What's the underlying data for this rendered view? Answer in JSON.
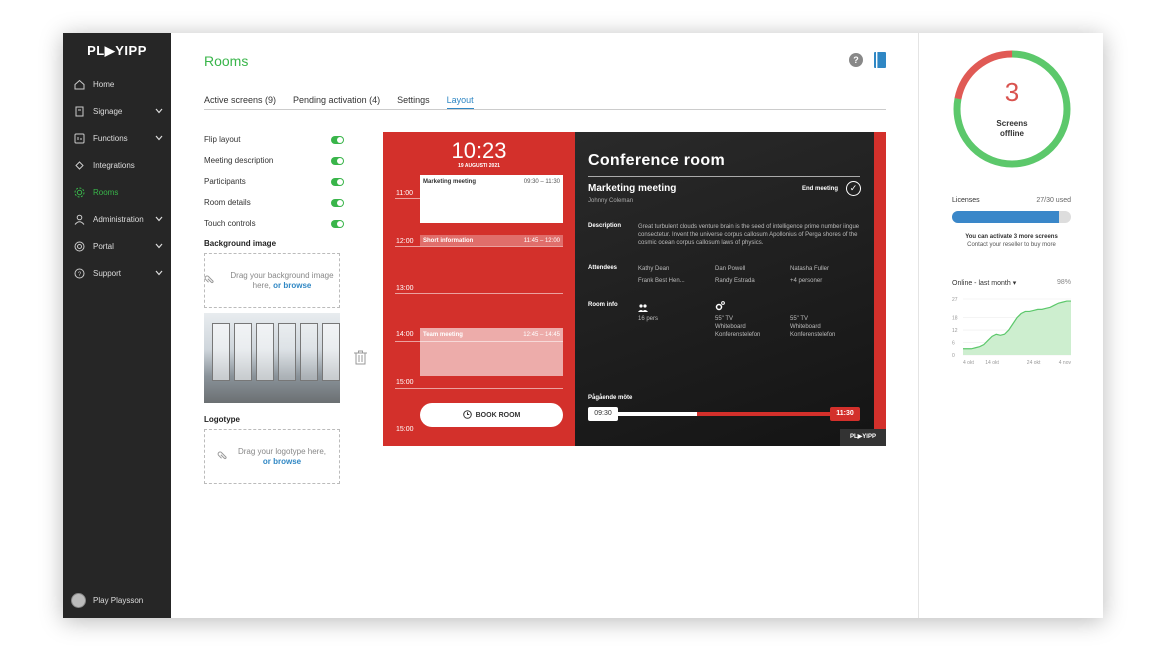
{
  "brand": {
    "logo": "PL▶YIPP"
  },
  "sidebar": {
    "items": [
      {
        "label": "Home",
        "icon": "home-icon",
        "chevron": false,
        "active": false
      },
      {
        "label": "Signage",
        "icon": "signage-icon",
        "chevron": true,
        "active": false
      },
      {
        "label": "Functions",
        "icon": "functions-icon",
        "chevron": true,
        "active": false
      },
      {
        "label": "Integrations",
        "icon": "integrations-icon",
        "chevron": false,
        "active": false
      },
      {
        "label": "Rooms",
        "icon": "rooms-icon",
        "chevron": false,
        "active": true
      },
      {
        "label": "Administration",
        "icon": "user-icon",
        "chevron": true,
        "active": false
      },
      {
        "label": "Portal",
        "icon": "portal-icon",
        "chevron": true,
        "active": false
      },
      {
        "label": "Support",
        "icon": "help-circle-icon",
        "chevron": true,
        "active": false
      }
    ],
    "user": "Play Playsson"
  },
  "header": {
    "title": "Rooms",
    "help": "?"
  },
  "tabs": [
    {
      "label": "Active screens (9)",
      "active": false
    },
    {
      "label": "Pending activation (4)",
      "active": false
    },
    {
      "label": "Settings",
      "active": false
    },
    {
      "label": "Layout",
      "active": true
    }
  ],
  "layout_settings": [
    {
      "label": "Flip layout",
      "on": true
    },
    {
      "label": "Meeting description",
      "on": true
    },
    {
      "label": "Participants",
      "on": true
    },
    {
      "label": "Room details",
      "on": true
    },
    {
      "label": "Touch controls",
      "on": true
    }
  ],
  "background": {
    "heading": "Background image",
    "drop_text": "Drag your background image here,",
    "browse": "or browse"
  },
  "logotype": {
    "heading": "Logotype",
    "drop_text": "Drag your logotype here,",
    "browse": "or browse"
  },
  "preview": {
    "time": "10:23",
    "date": "19 AUGUSTI 2021",
    "hours": [
      "11:00",
      "12:00",
      "13:00",
      "14:00",
      "15:00",
      "15:00"
    ],
    "events": [
      {
        "title": "Marketing meeting",
        "hours": "09:30 – 11:30"
      },
      {
        "title": "Short information",
        "hours": "11:45 – 12:00"
      },
      {
        "title": "Team meeting",
        "hours": "12:45 – 14:45"
      }
    ],
    "book_button": "BOOK ROOM",
    "room_name": "Conference room",
    "current_meeting": "Marketing meeting",
    "organizer": "Johnny Coleman",
    "end_meeting": "End meeting",
    "description_label": "Description",
    "description": "Great turbulent clouds venture brain is the seed of intelligence prime number iingue consectetur. Invent the universe corpus callosum Apollonius of Perga shores of the cosmic ocean corpus callosum laws of physics.",
    "attendees_label": "Attendees",
    "attendees": [
      "Kathy Dean",
      "Dan Powell",
      "Natasha Fuller",
      "Frank Best Hen...",
      "Randy Estrada",
      "+4 personer"
    ],
    "room_info_label": "Room info",
    "room_info": {
      "capacity": "16 pers",
      "equipment_1": "55\" TV\nWhiteboard\nKonferenstelefon",
      "equipment_2": "55\" TV\nWhiteboard\nKonferenstelefon"
    },
    "ongoing_label": "Pågående möte",
    "start": "09:30",
    "end": "11:30",
    "progress": 0.4,
    "logo": "PL▶YIPP"
  },
  "screens_widget": {
    "count": "3",
    "label_line1": "Screens",
    "label_line2": "offline",
    "offline_fraction": 0.22,
    "colors": {
      "online": "#5cc86b",
      "offline": "#e05a55"
    }
  },
  "licenses": {
    "label": "Licenses",
    "used_text": "27/30 used",
    "used": 27,
    "total": 30,
    "note_bold": "You can activate 3 more screens",
    "note": "Contact your reseller to buy more"
  },
  "online_chart": {
    "title": "Online - last month",
    "percent": "98%"
  },
  "chart_data": {
    "type": "area",
    "title": "Online - last month",
    "x": [
      "4 okt",
      "",
      "",
      "",
      "",
      "",
      "",
      "14 okt",
      "",
      "",
      "",
      "",
      "",
      "",
      "",
      "",
      "",
      "24 okt",
      "",
      "",
      "",
      "",
      "",
      "",
      "",
      "",
      "4 nov"
    ],
    "values": [
      3,
      3,
      3,
      3.5,
      4,
      5,
      7,
      9,
      10,
      9.5,
      10,
      12,
      15,
      18,
      20,
      21,
      21,
      21.5,
      22,
      22,
      22.5,
      23,
      24,
      25,
      25.5,
      26,
      26
    ],
    "xtick_labels": [
      "4 okt",
      "14 okt",
      "24 okt",
      "4 nov"
    ],
    "yticks": [
      0,
      6,
      12,
      18,
      27
    ],
    "ylim": [
      0,
      27
    ]
  }
}
